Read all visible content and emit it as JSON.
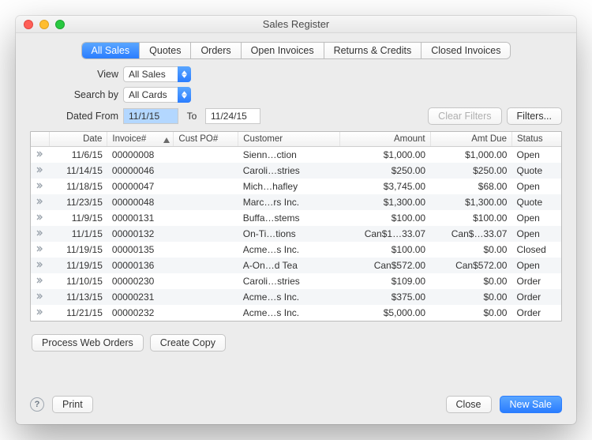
{
  "window": {
    "title": "Sales Register"
  },
  "tabs": [
    "All Sales",
    "Quotes",
    "Orders",
    "Open Invoices",
    "Returns & Credits",
    "Closed Invoices"
  ],
  "tabs_active_index": 0,
  "filters": {
    "view_label": "View",
    "view_value": "All Sales",
    "searchby_label": "Search by",
    "searchby_value": "All Cards",
    "datedfrom_label": "Dated From",
    "datedfrom_value": "11/1/15",
    "to_label": "To",
    "to_value": "11/24/15",
    "clear_label": "Clear Filters",
    "filters_label": "Filters..."
  },
  "columns": [
    "",
    "Date",
    "Invoice#",
    "Cust PO#",
    "Customer",
    "Amount",
    "Amt Due",
    "Status"
  ],
  "sort_col": "Invoice#",
  "rows": [
    {
      "date": "11/6/15",
      "inv": "00000008",
      "po": "",
      "cust": "Sienn…ction",
      "amt": "$1,000.00",
      "due": "$1,000.00",
      "status": "Open"
    },
    {
      "date": "11/14/15",
      "inv": "00000046",
      "po": "",
      "cust": "Caroli…stries",
      "amt": "$250.00",
      "due": "$250.00",
      "status": "Quote"
    },
    {
      "date": "11/18/15",
      "inv": "00000047",
      "po": "",
      "cust": "Mich…hafley",
      "amt": "$3,745.00",
      "due": "$68.00",
      "status": "Open"
    },
    {
      "date": "11/23/15",
      "inv": "00000048",
      "po": "",
      "cust": "Marc…rs Inc.",
      "amt": "$1,300.00",
      "due": "$1,300.00",
      "status": "Quote"
    },
    {
      "date": "11/9/15",
      "inv": "00000131",
      "po": "",
      "cust": "Buffa…stems",
      "amt": "$100.00",
      "due": "$100.00",
      "status": "Open"
    },
    {
      "date": "11/1/15",
      "inv": "00000132",
      "po": "",
      "cust": "On-Ti…tions",
      "amt": "Can$1…33.07",
      "due": "Can$…33.07",
      "status": "Open"
    },
    {
      "date": "11/19/15",
      "inv": "00000135",
      "po": "",
      "cust": "Acme…s Inc.",
      "amt": "$100.00",
      "due": "$0.00",
      "status": "Closed"
    },
    {
      "date": "11/19/15",
      "inv": "00000136",
      "po": "",
      "cust": "A-On…d Tea",
      "amt": "Can$572.00",
      "due": "Can$572.00",
      "status": "Open"
    },
    {
      "date": "11/10/15",
      "inv": "00000230",
      "po": "",
      "cust": "Caroli…stries",
      "amt": "$109.00",
      "due": "$0.00",
      "status": "Order"
    },
    {
      "date": "11/13/15",
      "inv": "00000231",
      "po": "",
      "cust": "Acme…s Inc.",
      "amt": "$375.00",
      "due": "$0.00",
      "status": "Order"
    },
    {
      "date": "11/21/15",
      "inv": "00000232",
      "po": "",
      "cust": "Acme…s Inc.",
      "amt": "$5,000.00",
      "due": "$0.00",
      "status": "Order"
    }
  ],
  "bottom": {
    "process": "Process Web Orders",
    "copy": "Create Copy"
  },
  "footer": {
    "help": "?",
    "print": "Print",
    "close": "Close",
    "newsale": "New Sale"
  }
}
